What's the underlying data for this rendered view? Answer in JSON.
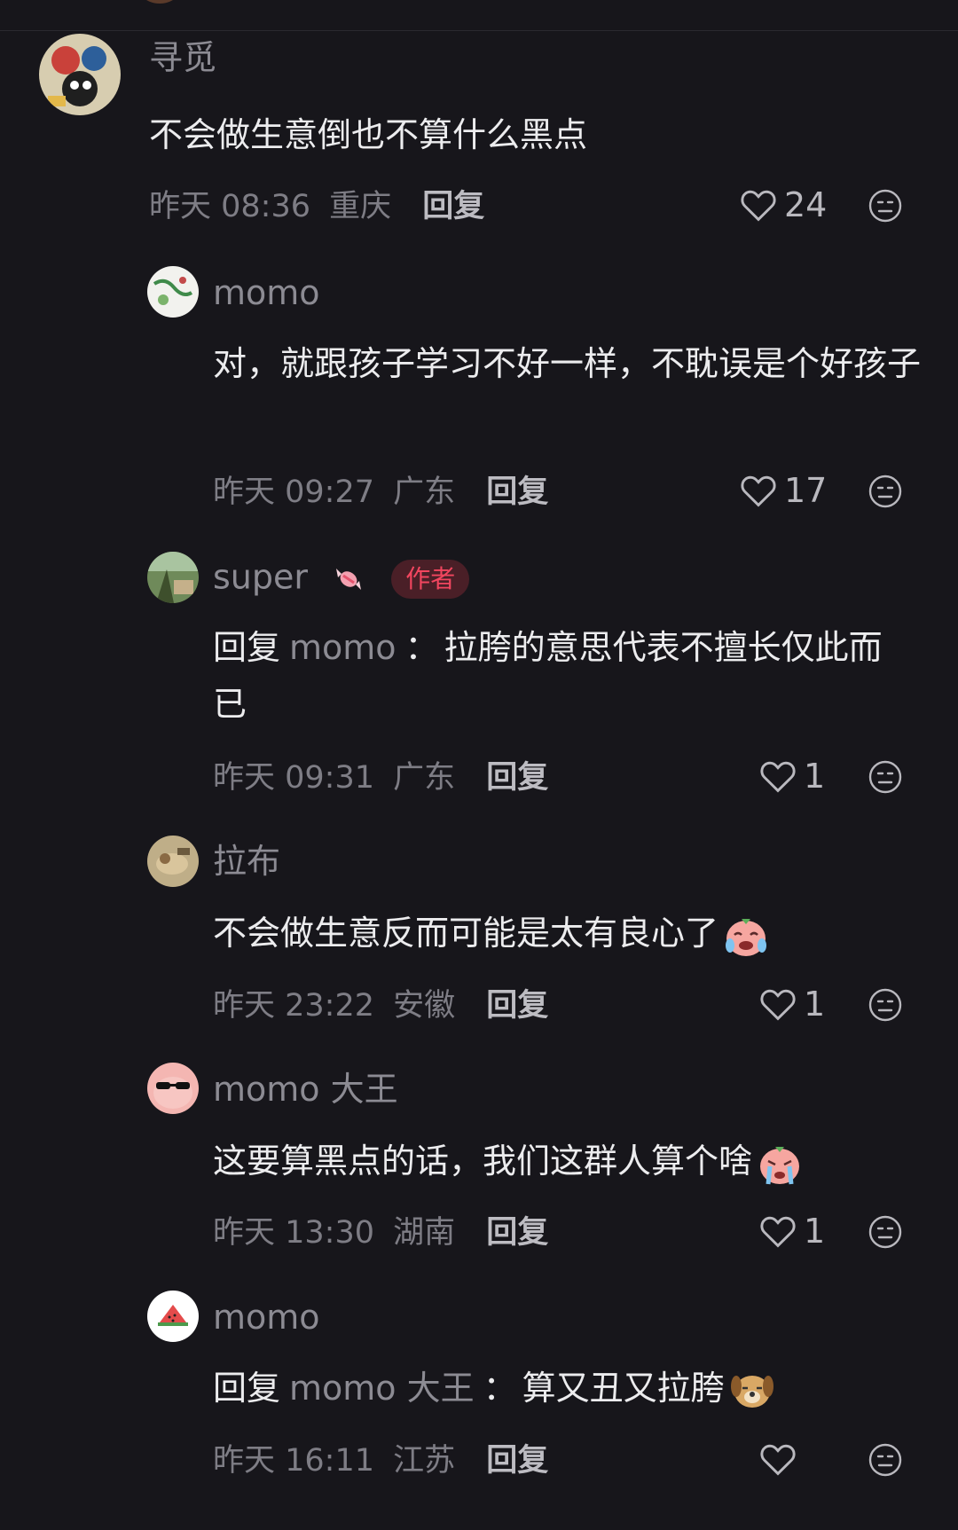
{
  "comments": [
    {
      "author": "寻觅",
      "text": "不会做生意倒也不算什么黑点",
      "time": "昨天 08:36",
      "location": "重庆",
      "reply_label": "回复",
      "likes": "24"
    },
    {
      "author": "momo",
      "text": "对，就跟孩子学习不好一样，不耽误是个好孩子",
      "time": "昨天 09:27",
      "location": "广东",
      "reply_label": "回复",
      "likes": "17"
    },
    {
      "author": "super",
      "badge": "作者",
      "reply_prefix": "回复",
      "reply_target": "momo",
      "reply_colon": "：",
      "text": "拉胯的意思代表不擅长仅此而已",
      "time": "昨天 09:31",
      "location": "广东",
      "reply_label": "回复",
      "likes": "1"
    },
    {
      "author": "拉布",
      "text": "不会做生意反而可能是太有良心了",
      "time": "昨天 23:22",
      "location": "安徽",
      "reply_label": "回复",
      "likes": "1"
    },
    {
      "author": "momo 大王",
      "text": "这要算黑点的话，我们这群人算个啥",
      "time": "昨天 13:30",
      "location": "湖南",
      "reply_label": "回复",
      "likes": "1"
    },
    {
      "author": "momo",
      "reply_prefix": "回复",
      "reply_target": "momo 大王",
      "reply_colon": "：",
      "text": "算又丑又拉胯",
      "time": "昨天 16:11",
      "location": "江苏",
      "reply_label": "回复",
      "likes": ""
    }
  ],
  "colors": {
    "background": "#17161b",
    "author_badge_bg": "#4a1f27",
    "author_badge_text": "#f2465f"
  }
}
